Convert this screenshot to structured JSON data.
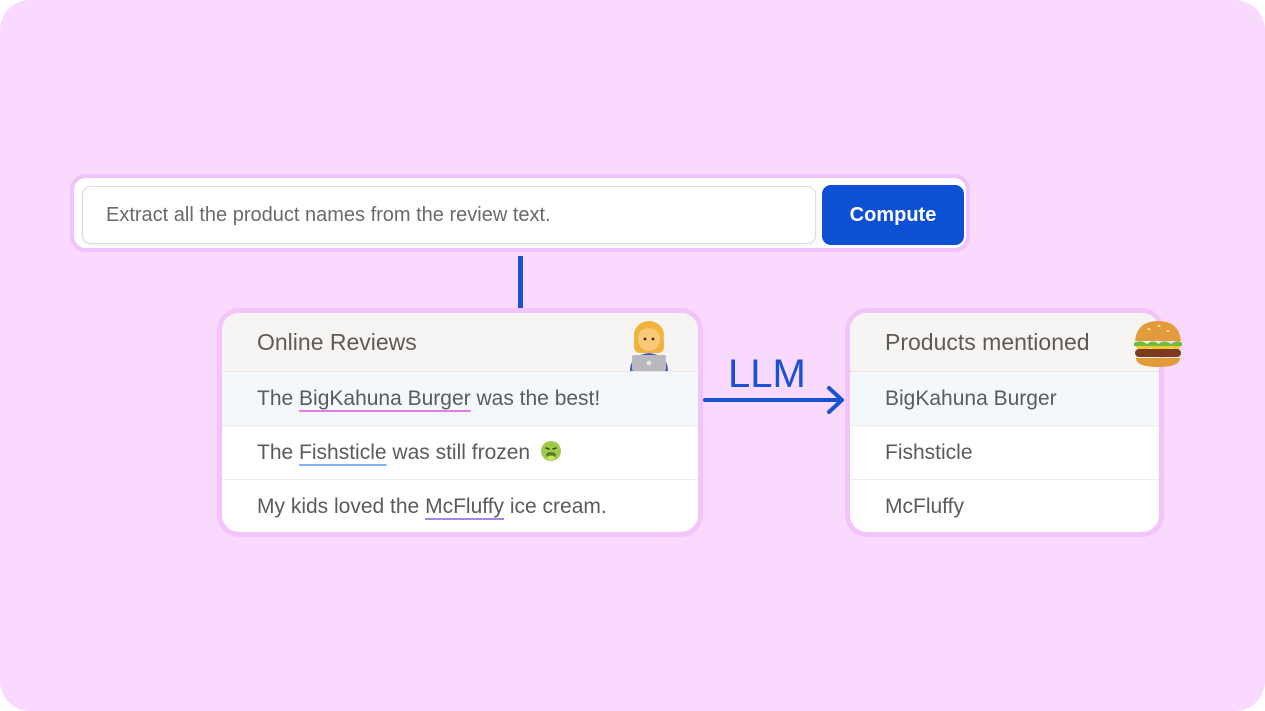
{
  "prompt": {
    "text": "Extract all the product names from the review text.",
    "button_label": "Compute"
  },
  "reviews_table": {
    "header": "Online Reviews",
    "header_icon": "person-with-laptop-icon",
    "rows": [
      {
        "before": "The ",
        "product": "BigKahuna Burger",
        "after": " was the best!",
        "underline_color": "#e07ee6"
      },
      {
        "before": "The ",
        "product": "Fishsticle",
        "after": " was still frozen",
        "underline_color": "#7fb3f0",
        "trailing_icon": "nauseated-face-icon"
      },
      {
        "before": "My kids loved the ",
        "product": "McFluffy",
        "after": " ice cream.",
        "underline_color": "#a586e8"
      }
    ]
  },
  "arrow": {
    "label": "LLM"
  },
  "products_table": {
    "header": "Products mentioned",
    "header_icon": "burger-icon",
    "rows": [
      "BigKahuna Burger",
      "Fishsticle",
      "McFluffy"
    ]
  },
  "colors": {
    "background": "#fad9ff",
    "accent": "#0e50d4",
    "connector": "#1a50d2"
  }
}
